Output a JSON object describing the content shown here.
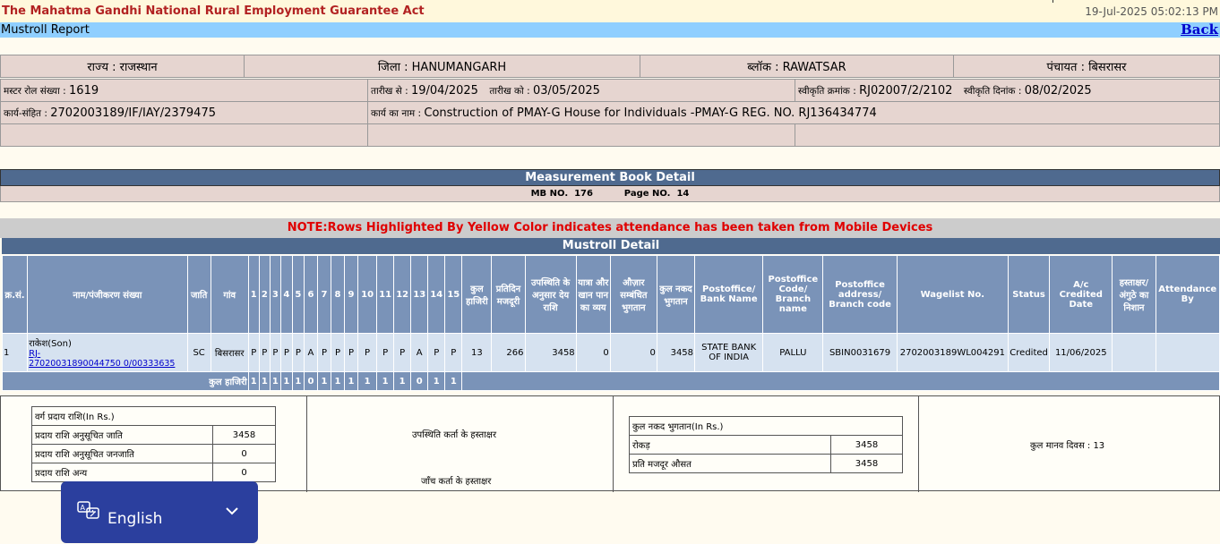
{
  "header": {
    "title": "The Mahatma Gandhi National Rural Employment Guarantee Act",
    "datetime": "19-Jul-2025 05:02:13 PM",
    "report_name": "Mustroll Report",
    "back": "Back"
  },
  "location": {
    "state": "राज्य : राजस्थान",
    "district": "जिला : HANUMANGARH",
    "block": "ब्लॉक : RAWATSAR",
    "panchayat": "पंचायत : बिसरासर"
  },
  "muster": {
    "no_label": "मस्टर रोल संख्या : ",
    "no": "1619",
    "from_label": "तारीख से : ",
    "from": "19/04/2025",
    "to_label": "तारीख को : ",
    "to": "03/05/2025",
    "sanction_no_label": "स्वीकृति क्रमांक : ",
    "sanction_no": "RJ02007/2/2102",
    "sanction_date_label": "स्वीकृति दिनांक : ",
    "sanction_date": "08/02/2025",
    "work_code_label": "कार्य-संहित : ",
    "work_code": "2702003189/IF/IAY/2379475",
    "work_name_label": "कार्य का नाम : ",
    "work_name": "Construction of PMAY-G House for Individuals -PMAY-G REG. NO. RJ136434774"
  },
  "mb": {
    "title": "Measurement Book Detail",
    "mb_no_label": "MB NO.",
    "mb_no": "176",
    "page_no_label": "Page NO.",
    "page_no": "14"
  },
  "note": "NOTE:Rows Highlighted By Yellow Color indicates attendance has been taken from Mobile Devices",
  "mustroll": {
    "title": "Mustroll Detail",
    "columns": [
      "क्र.सं.",
      "नाम/पंजीकरण संख्या",
      "जाति",
      "गांव",
      "1",
      "2",
      "3",
      "4",
      "5",
      "6",
      "7",
      "8",
      "9",
      "10",
      "11",
      "12",
      "13",
      "14",
      "15",
      "कुल हाजिरी",
      "प्रतिदिन मजदूरी",
      "उपस्थिति के अनुसार देय राशि",
      "यात्रा और खान पान का व्यय",
      "औज़ार सम्बंधित भुगतान",
      "कुल नकद भुगतान",
      "Postoffice/ Bank Name",
      "Postoffice Code/ Branch name",
      "Postoffice address/ Branch code",
      "Wagelist No.",
      "Status",
      "A/c Credited Date",
      "हस्ताक्षर/ अंगुठे का निशान",
      "Attendance By"
    ],
    "row": {
      "sno": "1",
      "name": "राकेश(Son)",
      "reg_no": "RJ-27020031890044750 0/00333635",
      "reg_line1": "RJ-",
      "reg_line2": "27020031890044750 0/00333635",
      "caste": "SC",
      "village": "बिसरासर",
      "days": [
        "P",
        "P",
        "P",
        "P",
        "P",
        "A",
        "P",
        "P",
        "P",
        "P",
        "P",
        "P",
        "A",
        "P",
        "P"
      ],
      "total_attendance": "13",
      "daily_wage": "266",
      "payable": "3458",
      "travel": "0",
      "tools": "0",
      "total_cash": "3458",
      "bank": "STATE BANK OF INDIA",
      "branch": "PALLU",
      "branch_code": "SBIN0031679",
      "wagelist": "2702003189WL004291",
      "status": "Credited",
      "credited_date": "11/06/2025",
      "signature": "",
      "attendance_by": ""
    },
    "total_label": "कुल हाजिरी",
    "total_days": [
      "1",
      "1",
      "1",
      "1",
      "1",
      "0",
      "1",
      "1",
      "1",
      "1",
      "1",
      "1",
      "0",
      "1",
      "1"
    ]
  },
  "summary": {
    "class_title": "वर्ग प्रदाय राशि(In Rs.)",
    "sc_label": "प्रदाय राशि अनुसूचित जाति",
    "sc_value": "3458",
    "st_label": "प्रदाय राशि अनुसूचित जनजाति",
    "st_value": "0",
    "other_label": "प्रदाय राशि अन्य",
    "other_value": "0",
    "sign_attendance": "उपस्थिति कर्ता के हस्ताक्षर",
    "sign_checker": "जाँच कर्ता के हस्ताक्षर",
    "cash_title": "कुल नकद भुगतान(In Rs.)",
    "cash_label": "रोकड़",
    "cash_value": "3458",
    "avg_label": "प्रति मजदूर औसत",
    "avg_value": "3458",
    "mandays": "कुल मानव दिवस : 13"
  },
  "language": {
    "label": "English"
  }
}
